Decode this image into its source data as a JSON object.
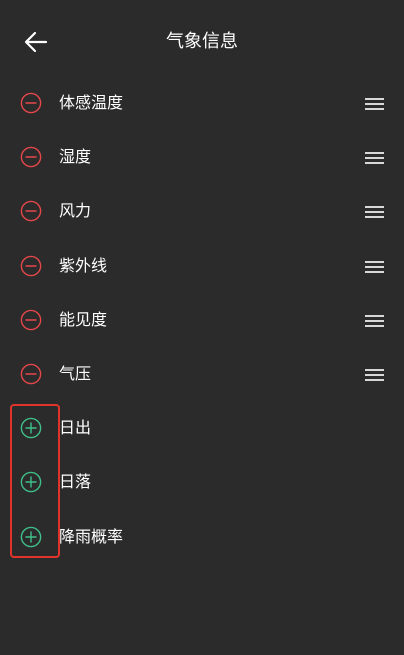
{
  "header": {
    "title": "气象信息",
    "back_icon": "arrow-left-icon"
  },
  "colors": {
    "background": "#2b2b2b",
    "remove": "#e8474a",
    "add": "#3fc08a",
    "highlight": "#e0342b",
    "text": "#ffffff",
    "drag_handle": "#d8d8d8"
  },
  "enabled_items": [
    {
      "label": "体感温度",
      "icon": "minus-circle-icon",
      "handle": "drag-handle-icon"
    },
    {
      "label": "湿度",
      "icon": "minus-circle-icon",
      "handle": "drag-handle-icon"
    },
    {
      "label": "风力",
      "icon": "minus-circle-icon",
      "handle": "drag-handle-icon"
    },
    {
      "label": "紫外线",
      "icon": "minus-circle-icon",
      "handle": "drag-handle-icon"
    },
    {
      "label": "能见度",
      "icon": "minus-circle-icon",
      "handle": "drag-handle-icon"
    },
    {
      "label": "气压",
      "icon": "minus-circle-icon",
      "handle": "drag-handle-icon"
    }
  ],
  "available_items": [
    {
      "label": "日出",
      "icon": "plus-circle-icon"
    },
    {
      "label": "日落",
      "icon": "plus-circle-icon"
    },
    {
      "label": "降雨概率",
      "icon": "plus-circle-icon"
    }
  ]
}
